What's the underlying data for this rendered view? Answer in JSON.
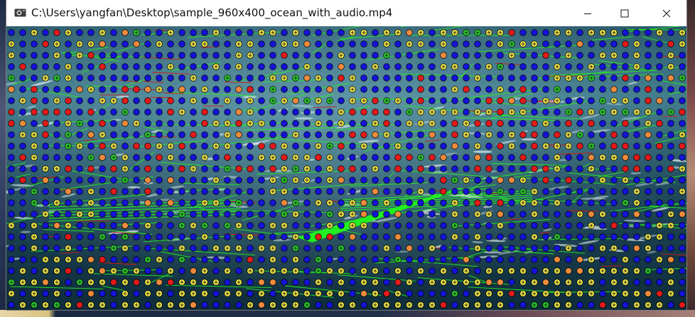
{
  "window": {
    "title": "C:\\Users\\yangfan\\Desktop\\sample_960x400_ocean_with_audio.mp4",
    "icons": {
      "app": "video-camera-icon",
      "minimize": "minimize-icon",
      "maximize": "maximize-icon",
      "close": "close-icon"
    }
  },
  "video": {
    "file_name": "sample_960x400_ocean_with_audio.mp4",
    "overlay": "motion-vector-and-macroblock-debug-visualization",
    "colors": {
      "water_dark": "#163847",
      "water_light": "#4f8797",
      "block_blue": "#1414d8",
      "block_yellow": "#f2e84a",
      "block_red": "#e41a1a",
      "block_orange": "#f08a3c",
      "block_green": "#2fd12f",
      "motion_vector": "#22ee22",
      "motion_vector_red": "#d01818"
    }
  }
}
